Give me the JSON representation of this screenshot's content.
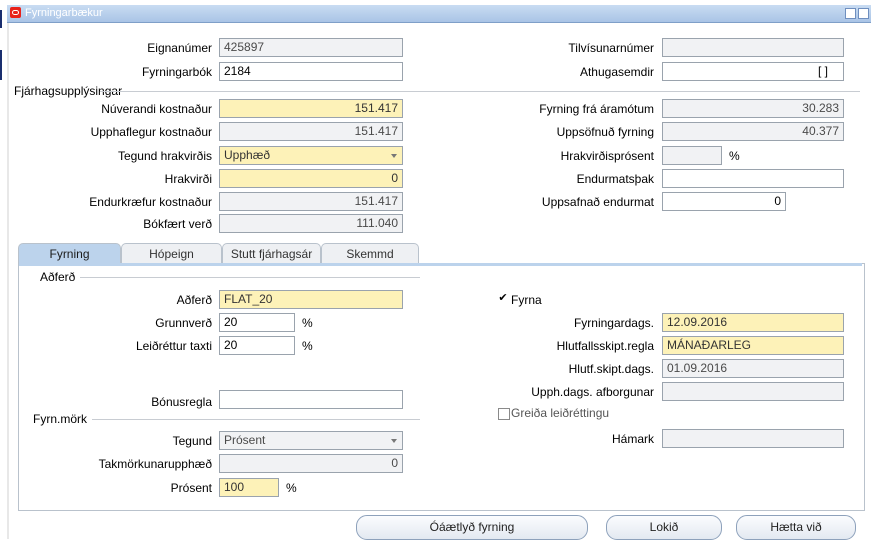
{
  "window": {
    "title": "Fyrningarbækur"
  },
  "top": {
    "eignanumer": {
      "label": "Eignanúmer",
      "value": "425897"
    },
    "fyrningarbok": {
      "label": "Fyrningarbók",
      "value": "2184"
    },
    "tilvisunarnumer": {
      "label": "Tilvísunarnúmer",
      "value": ""
    },
    "athugasemdir": {
      "label": "Athugasemdir",
      "value": "",
      "bracket": "[ ]"
    }
  },
  "fin": {
    "section": "Fjárhagsupplýsingar",
    "nuverandi": {
      "label": "Núverandi kostnaður",
      "value": "151.417"
    },
    "upphaflegur": {
      "label": "Upphaflegur kostnaður",
      "value": "151.417"
    },
    "tegund_hrakvirdis": {
      "label": "Tegund hrakvirðis",
      "value": "Upphæð"
    },
    "hrakvirdi": {
      "label": "Hrakvirði",
      "value": "0"
    },
    "endurkraefur": {
      "label": "Endurkræfur kostnaður",
      "value": "151.417"
    },
    "bokfaert": {
      "label": "Bókfært verð",
      "value": "111.040"
    },
    "fyrning_fra": {
      "label": "Fyrning frá áramótum",
      "value": "30.283"
    },
    "uppsofnud": {
      "label": "Uppsöfnuð fyrning",
      "value": "40.377"
    },
    "hrakvirdisprosent": {
      "label": "Hrakvirðisprósent",
      "value": "",
      "unit": "%"
    },
    "endurmatsthak": {
      "label": "Endurmatsþak",
      "value": ""
    },
    "uppsafnad_endurmat": {
      "label": "Uppsafnað endurmat",
      "value": "0"
    }
  },
  "tabs": [
    {
      "label": "Fyrning"
    },
    {
      "label": "Hópeign"
    },
    {
      "label": "Stutt fjárhagsár"
    },
    {
      "label": "Skemmd"
    }
  ],
  "panel": {
    "adferd_section": "Aðferð",
    "adferd": {
      "label": "Aðferð",
      "value": "FLAT_20"
    },
    "grunnverd": {
      "label": "Grunnverð",
      "value": "20",
      "unit": "%"
    },
    "leidrettur": {
      "label": "Leiðréttur taxti",
      "value": "20",
      "unit": "%"
    },
    "bonusregla": {
      "label": "Bónusregla",
      "value": ""
    },
    "fyrna": {
      "label": "Fyrna",
      "checked": true,
      "check": "✔"
    },
    "fyrningardags": {
      "label": "Fyrningardags.",
      "value": "12.09.2016"
    },
    "hlutfallsskipt": {
      "label": "Hlutfallsskipt.regla",
      "value": "MÁNAÐARLEG"
    },
    "hlutf_skipt_dags": {
      "label": "Hlutf.skipt.dags.",
      "value": "01.09.2016"
    },
    "upph_dags": {
      "label": "Upph.dags. afborgunar",
      "value": ""
    },
    "greida": {
      "label": "Greiða leiðréttingu",
      "checked": false
    },
    "hamark": {
      "label": "Hámark",
      "value": ""
    },
    "mork_section": "Fyrn.mörk",
    "tegund": {
      "label": "Tegund",
      "value": "Prósent"
    },
    "takmorkun": {
      "label": "Takmörkunarupphæð",
      "value": "0"
    },
    "prosent": {
      "label": "Prósent",
      "value": "100",
      "unit": "%"
    }
  },
  "buttons": {
    "oaetlud": "Óáætlyð fyrning",
    "lokid": "Lokið",
    "haetta": "Hætta við"
  }
}
